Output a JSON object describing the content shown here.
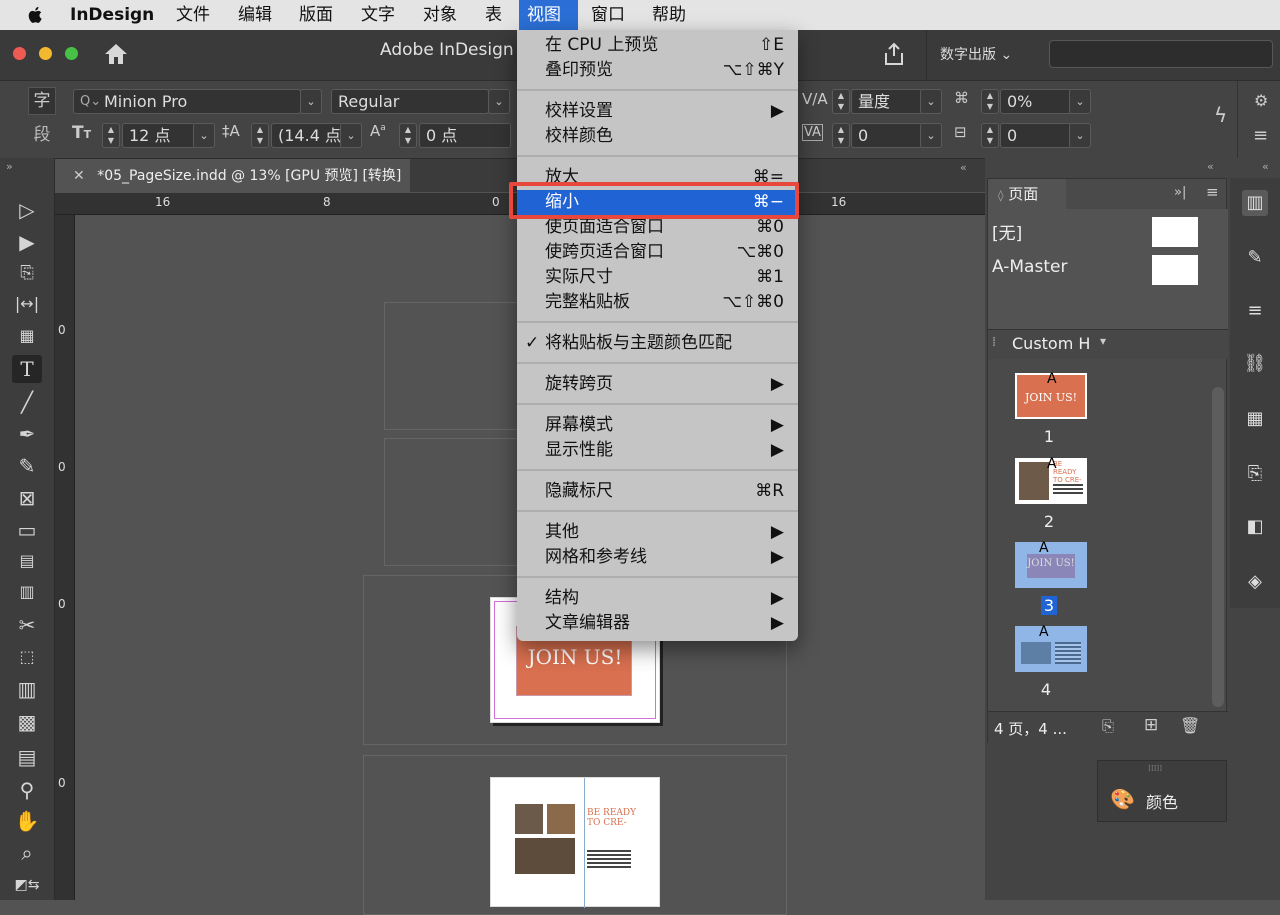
{
  "menubar": {
    "app": "InDesign",
    "items": [
      "文件",
      "编辑",
      "版面",
      "文字",
      "对象",
      "表",
      "视图",
      "窗口",
      "帮助"
    ],
    "selected": "视图"
  },
  "window": {
    "title": "Adobe InDesign",
    "publish_label": "数字出版",
    "search_placeholder": ""
  },
  "control": {
    "char_icon": "字",
    "para_icon": "段",
    "font_family": "Minion Pro",
    "font_style": "Regular",
    "font_size": "12 点",
    "leading": "(14.4 点",
    "baseline_shift": "0 点",
    "kerning": "量度",
    "tracking_pct": "0%",
    "tracking": "0",
    "skew": "0"
  },
  "document": {
    "tab_title": "*05_PageSize.indd @ 13% [GPU 预览] [转换]",
    "close_symbol": "✕"
  },
  "ruler": {
    "h": [
      "16",
      "8",
      "0",
      "16"
    ],
    "v": [
      "0",
      "0",
      "0",
      "0"
    ]
  },
  "view_menu": {
    "groups": [
      [
        {
          "label": "在 CPU 上预览",
          "key": "⇧E"
        },
        {
          "label": "叠印预览",
          "key": "⌥⇧⌘Y"
        }
      ],
      [
        {
          "label": "校样设置",
          "key": "▶"
        },
        {
          "label": "校样颜色",
          "key": ""
        }
      ],
      [
        {
          "label": "放大",
          "key": "⌘="
        },
        {
          "label": "缩小",
          "key": "⌘−",
          "highlighted": true
        },
        {
          "label": "使页面适合窗口",
          "key": "⌘0"
        },
        {
          "label": "使跨页适合窗口",
          "key": "⌥⌘0"
        },
        {
          "label": "实际尺寸",
          "key": "⌘1"
        },
        {
          "label": "完整粘贴板",
          "key": "⌥⇧⌘0"
        }
      ],
      [
        {
          "label": "将粘贴板与主题颜色匹配",
          "key": "",
          "checked": true
        }
      ],
      [
        {
          "label": "旋转跨页",
          "key": "▶"
        }
      ],
      [
        {
          "label": "屏幕模式",
          "key": "▶"
        },
        {
          "label": "显示性能",
          "key": "▶"
        }
      ],
      [
        {
          "label": "隐藏标尺",
          "key": "⌘R"
        }
      ],
      [
        {
          "label": "其他",
          "key": "▶"
        },
        {
          "label": "网格和参考线",
          "key": "▶"
        }
      ],
      [
        {
          "label": "结构",
          "key": "▶"
        },
        {
          "label": "文章编辑器",
          "key": "▶"
        }
      ]
    ]
  },
  "pages_panel": {
    "title": "页面",
    "masters": [
      "[无]",
      "A-Master"
    ],
    "size_label": "Custom H",
    "pages": [
      "1",
      "2",
      "3",
      "4"
    ],
    "selected_page": "3",
    "status": "4 页，4 ...",
    "thumb_text_1": "JOIN US!",
    "thumb_text_2": "BE READY TO CRE-",
    "master_prefix": "A"
  },
  "color_panel": {
    "title": "颜色"
  },
  "canvas": {
    "page_headline": "JOIN US!",
    "page2_headline_1": "BE READY",
    "page2_headline_2": "TO CRE-"
  },
  "colors": {
    "accent": "#1f63d4",
    "highlight_border": "#e8483c",
    "brand_orange": "#d9704f"
  }
}
